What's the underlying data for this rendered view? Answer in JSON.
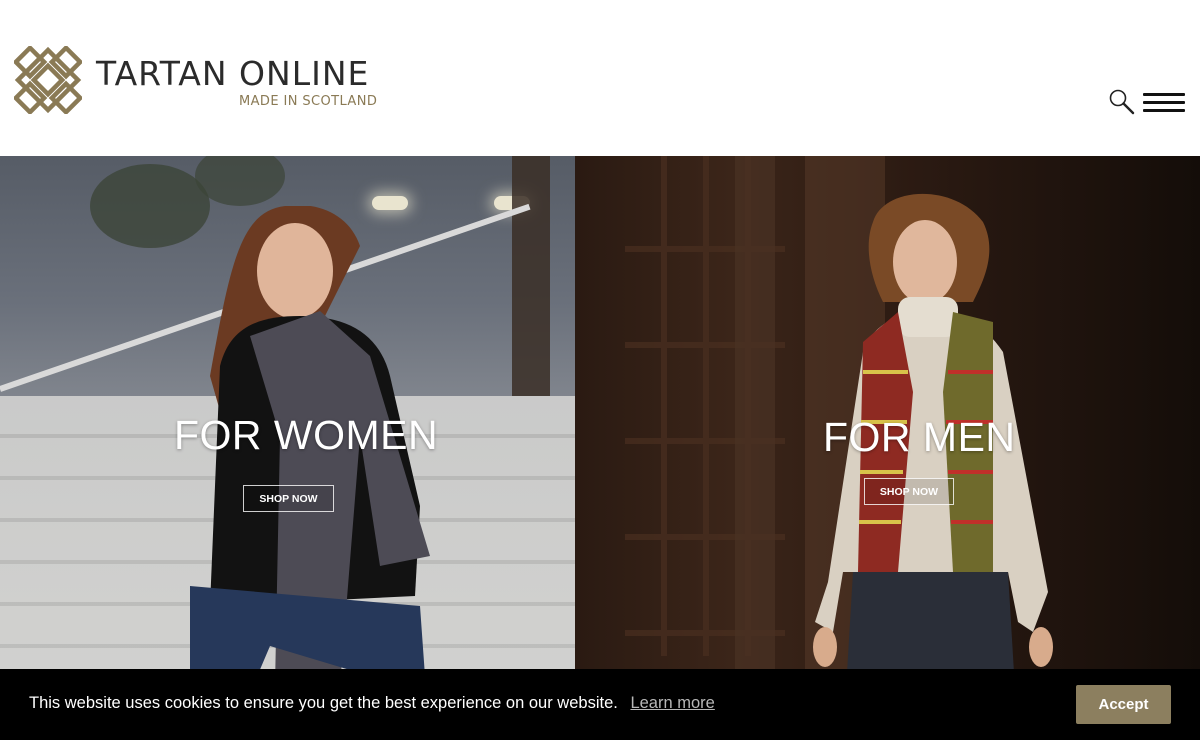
{
  "header": {
    "brand_name": "TARTAN ONLINE",
    "tagline": "MADE IN SCOTLAND",
    "search_icon": "search-icon",
    "menu_icon": "hamburger-menu-icon",
    "accent_color": "#8c7f5f"
  },
  "hero": {
    "women": {
      "title": "FOR WOMEN",
      "cta": "SHOP NOW"
    },
    "men": {
      "title": "FOR MEN",
      "cta": "SHOP NOW"
    }
  },
  "cookie_bar": {
    "message": "This website uses cookies to ensure you get the best experience on our website.",
    "learn_more": "Learn more",
    "accept": "Accept",
    "background_color": "#000000",
    "button_color": "#8c7f5f"
  }
}
